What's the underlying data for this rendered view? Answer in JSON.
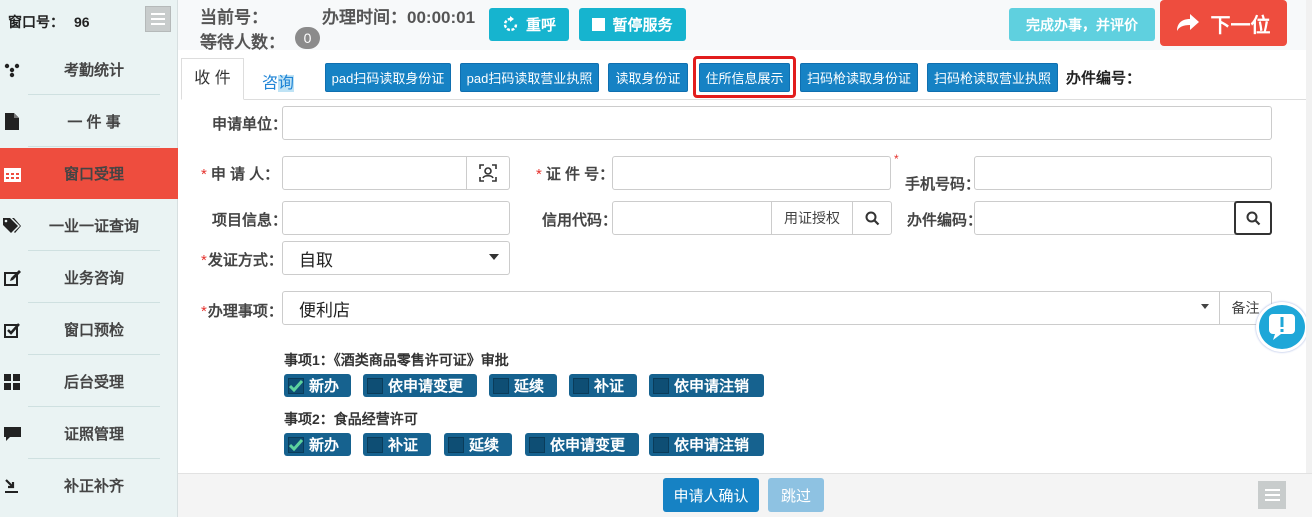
{
  "sidebar": {
    "window_label": "窗口号：",
    "window_no": "96",
    "items": [
      {
        "label": "考勤统计",
        "icon": "cog-icon"
      },
      {
        "label": "一 件 事",
        "icon": "file-icon"
      },
      {
        "label": "窗口受理",
        "icon": "calendar-icon",
        "active": true
      },
      {
        "label": "一业一证查询",
        "icon": "tags-icon"
      },
      {
        "label": "业务咨询",
        "icon": "edit-icon"
      },
      {
        "label": "窗口预检",
        "icon": "check-square-icon"
      },
      {
        "label": "后台受理",
        "icon": "grid-icon"
      },
      {
        "label": "证照管理",
        "icon": "comment-icon"
      },
      {
        "label": "补正补齐",
        "icon": "download-icon"
      }
    ]
  },
  "topbar": {
    "current_label": "当前号：",
    "time_label": "办理时间：00:00:01",
    "waiting_label": "等待人数：",
    "waiting_count": "0",
    "recall": "重呼",
    "pause": "暂停服务",
    "finish": "完成办事，并评价",
    "next": "下一位"
  },
  "tabs": {
    "receive": "收 件",
    "consult_a": "咨",
    "consult_b": "询"
  },
  "toolbar": {
    "buttons": [
      "pad扫码读取身份证",
      "pad扫码读取营业执照",
      "读取身份证",
      "住所信息展示",
      "扫码枪读取身份证",
      "扫码枪读取营业执照"
    ],
    "case_no_label": "办件编号："
  },
  "form": {
    "applicant_unit": "申请单位：",
    "applicant": "申 请 人：",
    "id_no": "证 件 号：",
    "phone": "手机号码：",
    "project": "项目信息：",
    "credit_code": "信用代码：",
    "credit_auth": "用证授权",
    "case_code": "办件编码：",
    "cert_method": "发证方式：",
    "cert_method_value": "自取",
    "matter": "办理事项：",
    "matter_value": "便利店",
    "remark": "备注"
  },
  "matters": [
    {
      "title": "事项1：《酒类商品零售许可证》审批",
      "options": [
        {
          "label": "新办",
          "checked": true
        },
        {
          "label": "依申请变更",
          "checked": false
        },
        {
          "label": "延续",
          "checked": false
        },
        {
          "label": "补证",
          "checked": false
        },
        {
          "label": "依申请注销",
          "checked": false
        }
      ]
    },
    {
      "title": "事项2：食品经营许可",
      "options": [
        {
          "label": "新办",
          "checked": true
        },
        {
          "label": "补证",
          "checked": false
        },
        {
          "label": "延续",
          "checked": false
        },
        {
          "label": "依申请变更",
          "checked": false
        },
        {
          "label": "依申请注销",
          "checked": false
        }
      ]
    }
  ],
  "footer": {
    "confirm": "申请人确认",
    "skip": "跳过"
  }
}
